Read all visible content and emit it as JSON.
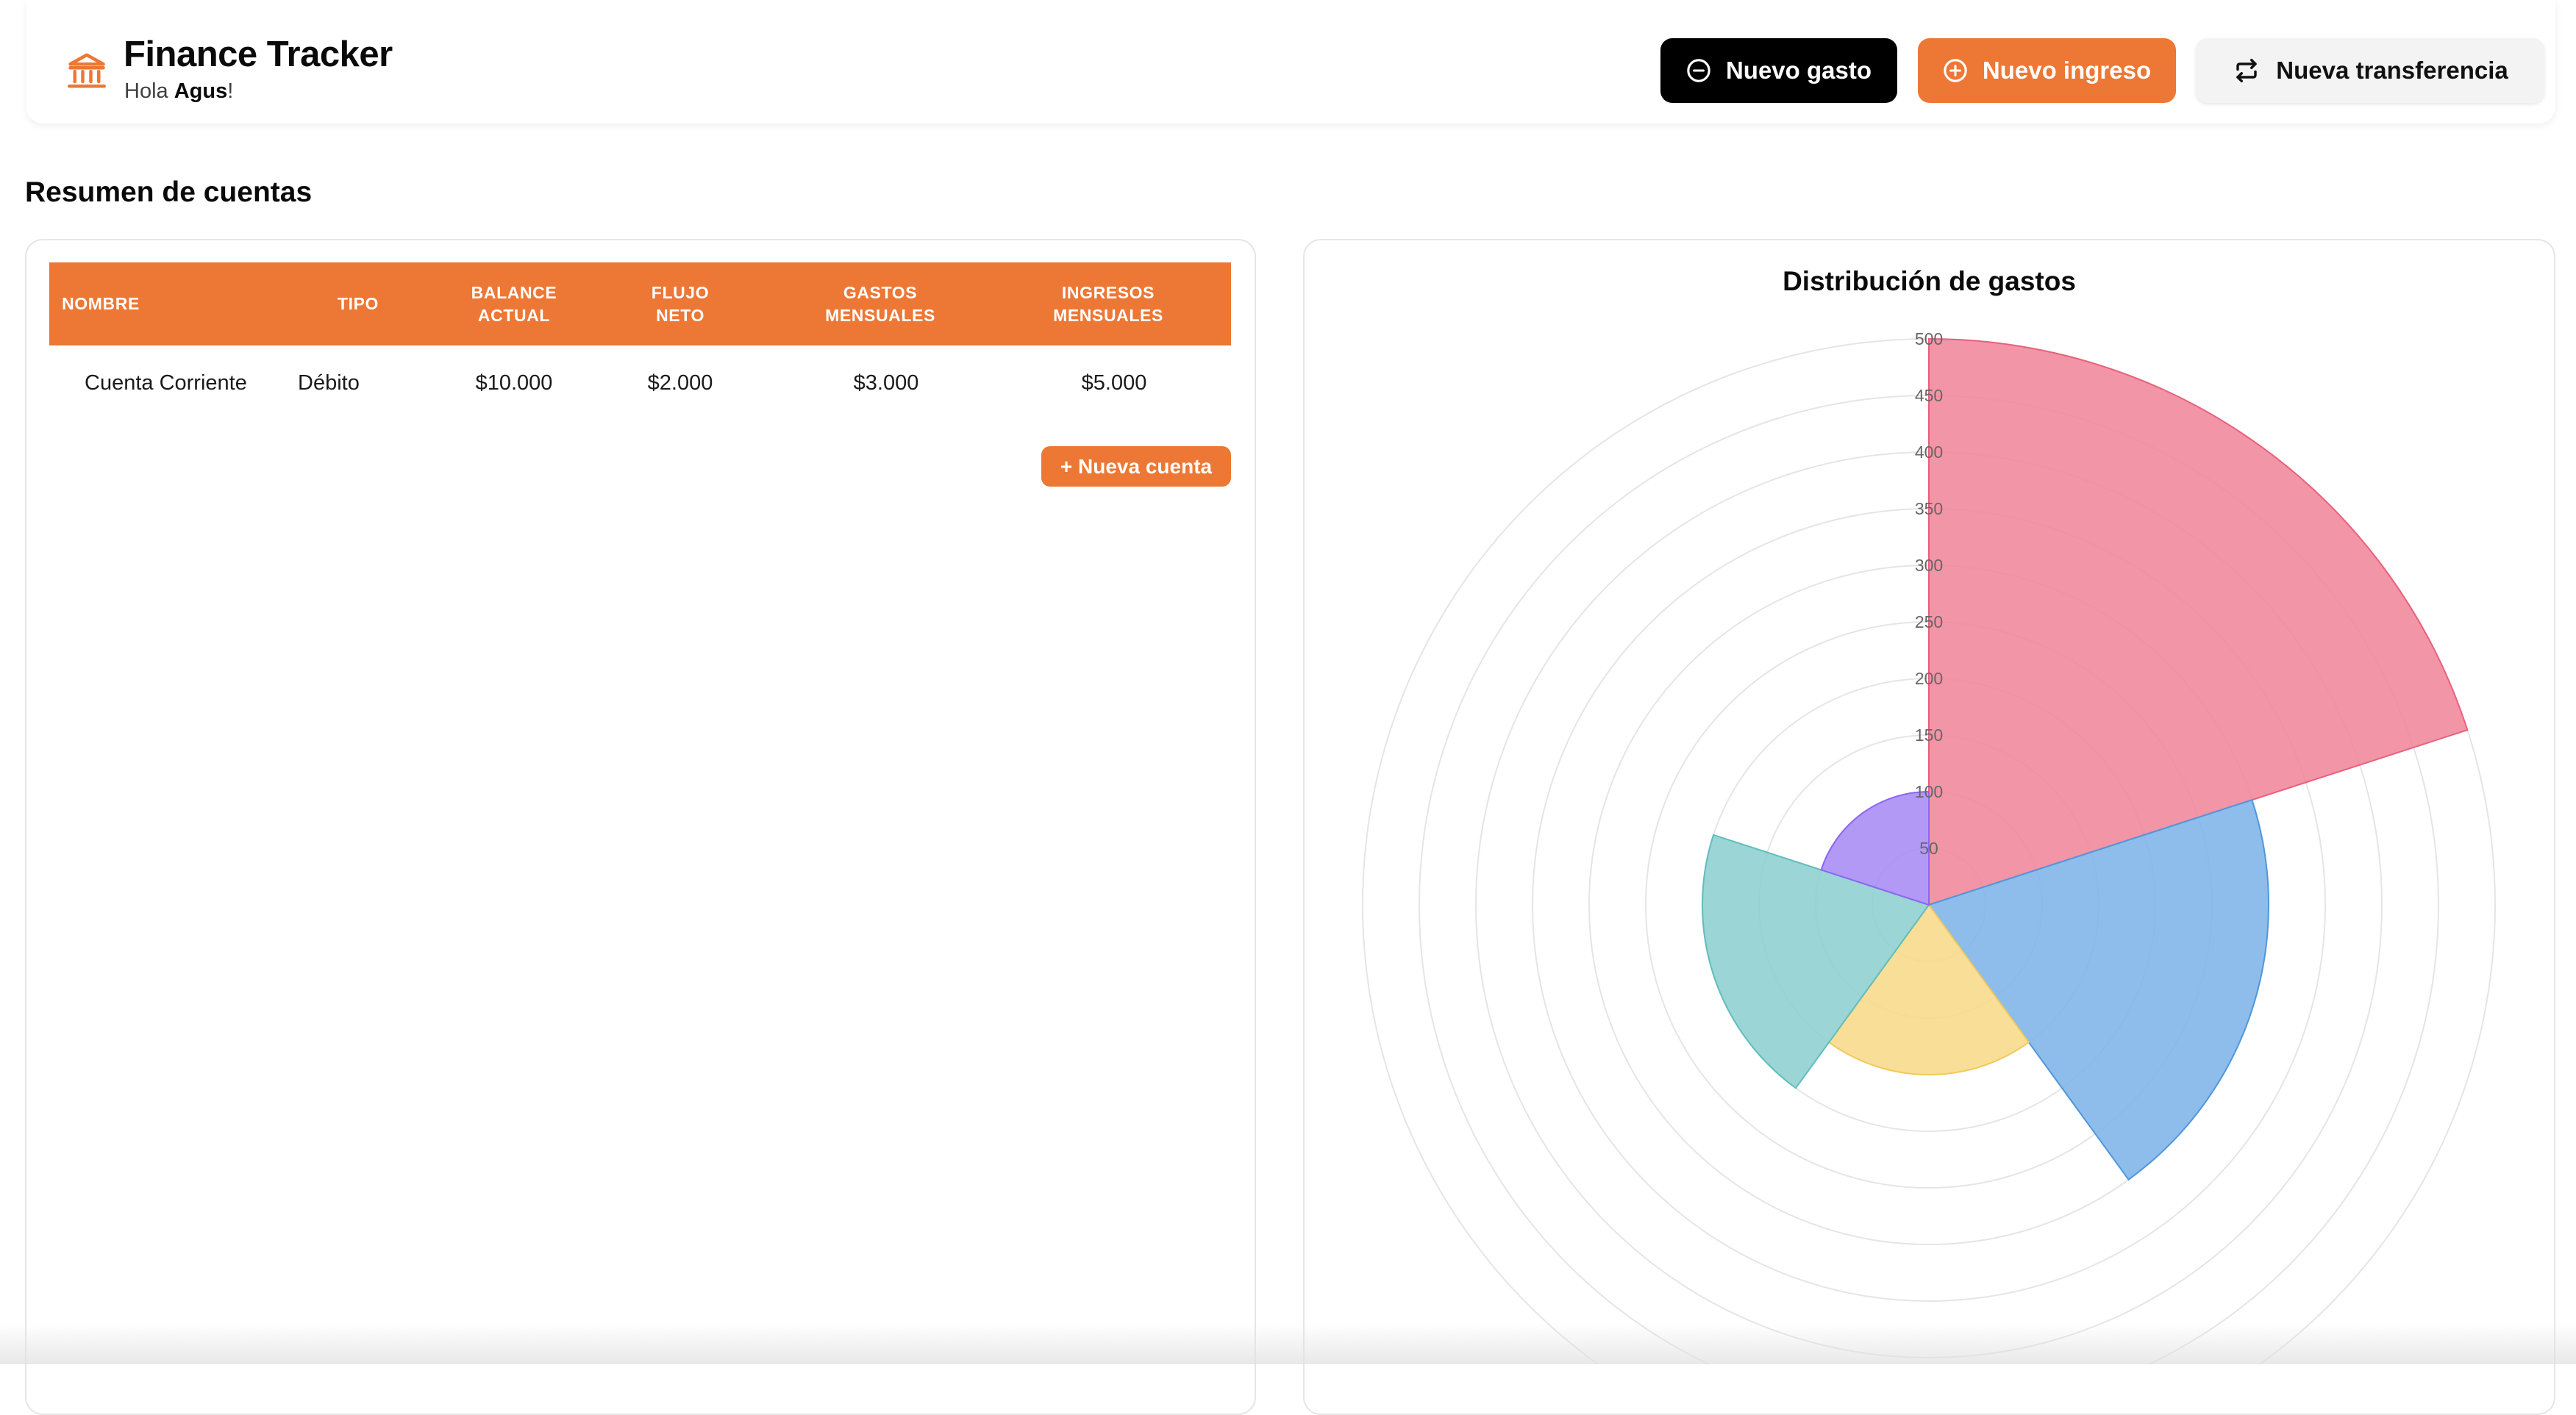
{
  "header": {
    "title": "Finance Tracker",
    "greeting_prefix": "Hola ",
    "user_name": "Agus",
    "greeting_suffix": "!",
    "brand_icon": "bank-icon",
    "buttons": {
      "new_expense": "Nuevo gasto",
      "new_income": "Nuevo ingreso",
      "new_transfer": "Nueva transferencia"
    }
  },
  "colors": {
    "accent": "#ed7734",
    "primary_dark": "#000000",
    "secondary_bg": "#f3f3f4"
  },
  "accounts": {
    "section_title": "Resumen de cuentas",
    "columns": [
      "Nombre",
      "Tipo",
      "Balance actual",
      "Flujo neto",
      "Gastos mensuales",
      "Ingresos mensuales"
    ],
    "rows": [
      [
        "Cuenta Corriente",
        "Débito",
        "$10.000",
        "$2.000",
        "$3.000",
        "$5.000"
      ]
    ],
    "new_account_button": "+ Nueva cuenta"
  },
  "chart_data": {
    "type": "polarArea",
    "title": "Distribución de gastos",
    "r_ticks": [
      50,
      100,
      150,
      200,
      250,
      300,
      350,
      400,
      450,
      500
    ],
    "r_range": [
      0,
      500
    ],
    "grid": true,
    "values": [
      500,
      300,
      150,
      200,
      100
    ],
    "colors": [
      "#f0869b",
      "#7eb4e8",
      "#f8d98a",
      "#8dcfcf",
      "#a98bf5"
    ],
    "border_colors": [
      "#e8617d",
      "#4f97dc",
      "#f3c95a",
      "#62bdbd",
      "#8c66f2"
    ]
  }
}
